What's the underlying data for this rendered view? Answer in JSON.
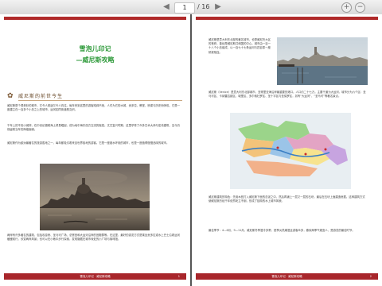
{
  "toolbar": {
    "prev_icon": "back-arrow-icon",
    "next_icon": "forward-arrow-icon",
    "current_page": "1",
    "total_pages": "/ 16",
    "zoom_in_icon": "plus-circle-icon",
    "zoom_out_icon": "minus-circle-icon"
  },
  "left_page": {
    "title_line1": "雪泡儿印记",
    "title_line2": "—威尼斯攻略",
    "section_heading": "威尼斯的前世今生",
    "para1": "威尼斯是个很奇妙的城市，它令人着迷又令人向往。每年来到这里的游客络绎不绝，人们为它的水城、贡多拉、教堂、桥梁与历史而惊叹。它是一座建立在一百多个小岛之上的城市，运河如同街道般交织。",
    "para2": "千年上的不安小城邦，在中世纪借助海上贸易崛起，成为地中海东西方交流的枢纽。文艺复兴时期，这里孕育了众多艺术大师与宏伟建筑，至今仍保留着当年的辉煌面貌。",
    "para3": "威尼斯作为欧洲最著名的旅游胜地之一，每年都吸引着来自世界各地的游客。它是一座被水环绕的城市，也是一座值得慢慢品味的城市。",
    "para4": "两岸有许多著名的建筑，包括叹息桥、圣马可广场、总督宫和大运河沿岸的宫殿群等。在这里，最好的游览方式是乘坐贡多拉或水上巴士沿着运河缓缓前行，欣赏两岸风景；也可以在小巷中步行探索，发现隐藏在城市深处的小广场与咖啡馆。",
    "footer_title": "雪泡儿印记 · 威尼斯攻略",
    "footer_page": "1"
  },
  "right_page": {
    "para1": "威尼斯是意大利东北部的著名城市，也是威尼托大区的首府，曾经是威尼斯共和国的中心。城市由一百一十八个小岛组成，以一百七十七条运河与四百零一座桥梁相连。",
    "para2": "威尼斯（Venice）是意大利东北部城市，亚得里亚海沿岸最重要的港口。人口约二十七万。主要干道为大运河，城市分为六个区：圣马可区、卡纳雷吉欧区、城堡区、多尔索杜罗区、圣十字区与圣保罗区，另有“大运河”、“圣马可”等著名景点。",
    "para3": "威尼斯建筑的特色：先用木桩打入威尼斯下面的淤泥之中，然后再铺上一层又一层的石块，最后在石块上面建造房屋。这种建筑方式使威尼斯历经千年依然屹立不倒，形成了独特的水上城市风貌。",
    "para4": "最佳季节：4—6月、9—11月。威尼斯冬季湿冷多雾，夏季炎热潮湿且游客众多，春秋两季气候宜人，是游览的最佳时节。",
    "footer_title": "雪泡儿印记 · 威尼斯攻略",
    "footer_page": "2"
  }
}
